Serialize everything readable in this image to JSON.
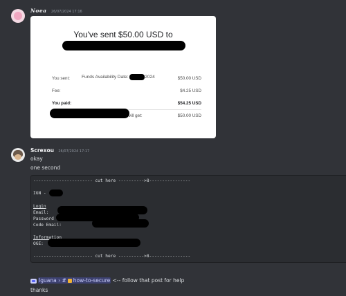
{
  "messages": [
    {
      "author": "Noea",
      "timestamp": "26/07/2024 17:16",
      "receipt": {
        "title": "You've sent $50.00 USD to",
        "availability_label": "Funds Availability Date:",
        "availability_year": "2024",
        "rows": [
          {
            "label": "You sent:",
            "value": "$50.00 USD"
          },
          {
            "label": "Fee:",
            "value": "$4.25 USD"
          },
          {
            "label": "You paid:",
            "value": "$54.25 USD"
          },
          {
            "label": "vill get:",
            "value": "$50.00 USD"
          }
        ]
      }
    },
    {
      "author": "Screxou",
      "timestamp": "26/07/2024 17:17",
      "lines": [
        "okay",
        "one second"
      ],
      "code": {
        "cut_line": "----------------------- cut here ---------->8----------------",
        "ign": "IGN -",
        "login_heading": "Login",
        "email_label": "Email:",
        "password_label": "Password",
        "code_email_label": "Code Email:",
        "info_heading": "Information",
        "oge_label": "OGE:"
      },
      "mention": {
        "server": "Iguana",
        "separator": "›",
        "hash": "#",
        "channel": "how-to-secure"
      },
      "follow_text": "<-- follow that post for help",
      "last_line": "thanks"
    }
  ],
  "colors": {
    "background": "#313338",
    "codeblock": "#2b2d31",
    "mention": "#5865f2"
  }
}
